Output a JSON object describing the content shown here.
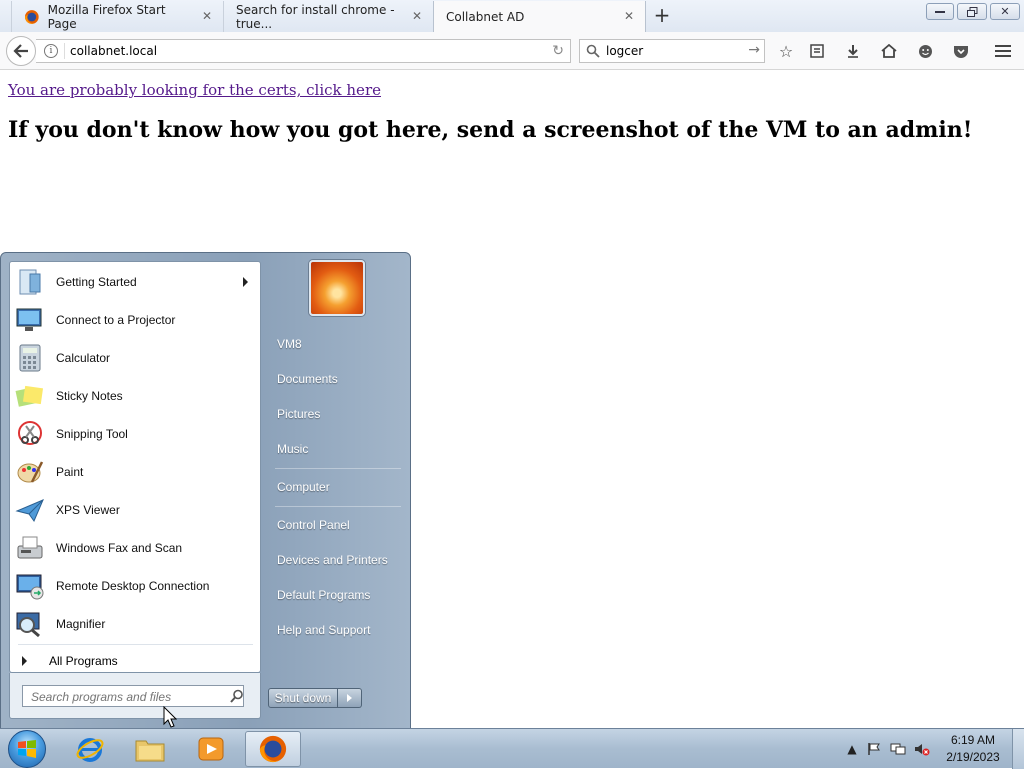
{
  "browser": {
    "tabs": [
      {
        "label": "Mozilla Firefox Start Page",
        "active": false
      },
      {
        "label": "Search for install chrome - true...",
        "active": false
      },
      {
        "label": "Collabnet AD",
        "active": true
      }
    ],
    "url": "collabnet.local",
    "search_value": "logcer"
  },
  "page": {
    "link_text": "You are probably looking for the certs, click here",
    "heading": "If you don't know how you got here, send a screenshot of the VM to an admin!"
  },
  "start_menu": {
    "programs": [
      {
        "label": "Getting Started",
        "icon": "getting-started-icon",
        "has_submenu": true
      },
      {
        "label": "Connect to a Projector",
        "icon": "projector-icon",
        "has_submenu": false
      },
      {
        "label": "Calculator",
        "icon": "calculator-icon",
        "has_submenu": false
      },
      {
        "label": "Sticky Notes",
        "icon": "sticky-notes-icon",
        "has_submenu": false
      },
      {
        "label": "Snipping Tool",
        "icon": "snipping-tool-icon",
        "has_submenu": false
      },
      {
        "label": "Paint",
        "icon": "paint-icon",
        "has_submenu": false
      },
      {
        "label": "XPS Viewer",
        "icon": "xps-viewer-icon",
        "has_submenu": false
      },
      {
        "label": "Windows Fax and Scan",
        "icon": "fax-scan-icon",
        "has_submenu": false
      },
      {
        "label": "Remote Desktop Connection",
        "icon": "remote-desktop-icon",
        "has_submenu": false
      },
      {
        "label": "Magnifier",
        "icon": "magnifier-icon",
        "has_submenu": false
      }
    ],
    "all_programs": "All Programs",
    "search_placeholder": "Search programs and files",
    "right_links": [
      "VM8",
      "Documents",
      "Pictures",
      "Music",
      "Computer",
      "Control Panel",
      "Devices and Printers",
      "Default Programs",
      "Help and Support"
    ],
    "shutdown_label": "Shut down"
  },
  "taskbar": {
    "pinned": [
      "internet-explorer-icon",
      "windows-explorer-icon",
      "media-player-icon",
      "firefox-icon"
    ],
    "clock_time": "6:19 AM",
    "clock_date": "2/19/2023"
  }
}
